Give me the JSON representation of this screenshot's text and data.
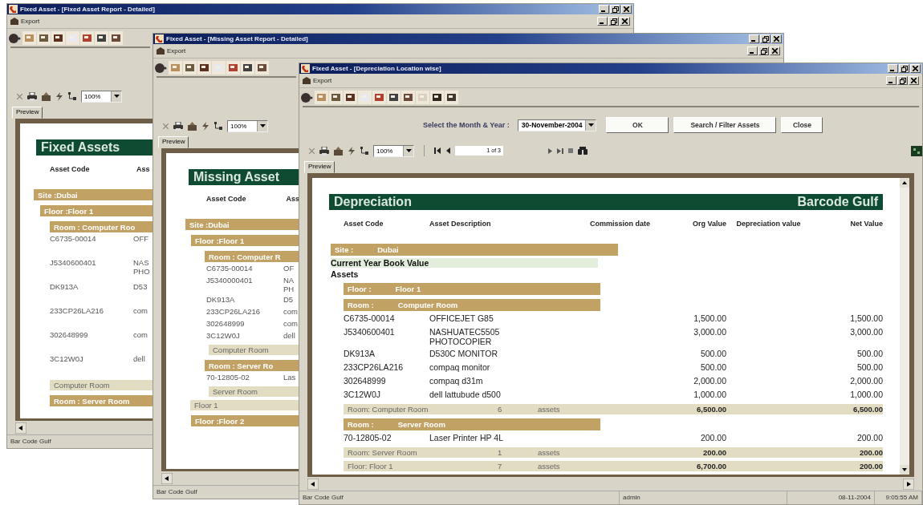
{
  "windows": [
    {
      "title": "Fixed Asset - [Fixed Asset Report - Detailed]",
      "menu": [
        "Export"
      ],
      "zoom": "100%",
      "tab": "Preview",
      "report": {
        "title": "Fixed Assets",
        "columns": [
          "Asset Code",
          "Ass"
        ],
        "lines": [
          {
            "kind": "site",
            "label": "Site :Dubai"
          },
          {
            "kind": "floor",
            "label": "Floor :Floor 1"
          },
          {
            "kind": "room",
            "label": "Room : Computer Roo"
          },
          {
            "kind": "item",
            "code": "C6735-00014",
            "description": [
              "OFF"
            ]
          },
          {
            "kind": "item",
            "code": "J5340600401",
            "description": [
              "NAS",
              "PHO"
            ]
          },
          {
            "kind": "item",
            "code": "DK913A",
            "description": [
              "D53"
            ]
          },
          {
            "kind": "item",
            "code": "233CP26LA216",
            "description": [
              "com"
            ]
          },
          {
            "kind": "item",
            "code": "302648999",
            "description": [
              "com"
            ]
          },
          {
            "kind": "item",
            "code": "3C12W0J",
            "description": [
              "dell"
            ]
          },
          {
            "kind": "room_total",
            "label": "Computer Room"
          },
          {
            "kind": "room",
            "label": "Room : Server Room"
          }
        ]
      },
      "status_bar": [
        "Bar Code Gulf"
      ]
    },
    {
      "title": "Fixed Asset - [Missing Asset Report - Detailed]",
      "menu": [
        "Export"
      ],
      "zoom": "100%",
      "tab": "Preview",
      "report": {
        "title": "Missing Asset",
        "columns": [
          "Asset Code",
          "Ass"
        ],
        "lines": [
          {
            "kind": "site",
            "label": "Site :Dubai"
          },
          {
            "kind": "floor",
            "label": "Floor :Floor 1"
          },
          {
            "kind": "room",
            "label": "Room : Computer R"
          },
          {
            "kind": "item",
            "code": "C6735-00014",
            "description": [
              "OF"
            ]
          },
          {
            "kind": "item",
            "code": "J5340000401",
            "description": [
              "NA",
              "PH"
            ]
          },
          {
            "kind": "item",
            "code": "DK913A",
            "description": [
              "D5"
            ]
          },
          {
            "kind": "item",
            "code": "233CP26LA216",
            "description": [
              "com"
            ]
          },
          {
            "kind": "item",
            "code": "302648999",
            "description": [
              "com"
            ]
          },
          {
            "kind": "item",
            "code": "3C12W0J",
            "description": [
              "dell"
            ]
          },
          {
            "kind": "room_total",
            "label": "Computer Room"
          },
          {
            "kind": "room",
            "label": "Room : Server Ro"
          },
          {
            "kind": "item",
            "code": "70-12805-02",
            "description": [
              "Las"
            ]
          },
          {
            "kind": "room_total",
            "label": "Server Room"
          },
          {
            "kind": "floor_total",
            "label": "Floor 1"
          },
          {
            "kind": "floor",
            "label": "Floor :Floor 2"
          }
        ]
      },
      "status_bar": [
        "Bar Code Gulf"
      ]
    },
    {
      "title": "Fixed Asset - [Depreciation Location wise]",
      "menu": [
        "Export"
      ],
      "zoom": "100%",
      "tab": "Preview",
      "filter": {
        "label": "Select the Month & Year :",
        "value": "30-November-2004",
        "buttons": [
          "OK",
          "Search / Filter Assets",
          "Close"
        ]
      },
      "pager": {
        "page": "1 of 3"
      },
      "report": {
        "title": "Depreciation",
        "company": "Barcode Gulf",
        "columns": [
          "Asset Code",
          "Asset Description",
          "Commission date",
          "Org Value",
          "Depreciation value",
          "Net Value"
        ],
        "lines": [
          {
            "kind": "site",
            "label": "Site :",
            "value": "Dubai"
          },
          {
            "kind": "book",
            "label": "Current Year Book Value"
          },
          {
            "kind": "heading",
            "label": "Assets"
          },
          {
            "kind": "floor",
            "label": "Floor :",
            "value": "Floor 1"
          },
          {
            "kind": "room",
            "label": "Room :",
            "value": "Computer Room"
          },
          {
            "kind": "item",
            "code": "C6735-00014",
            "description": [
              "OFFICEJET G85"
            ],
            "org_value": "1,500.00",
            "net_value": "1,500.00"
          },
          {
            "kind": "item",
            "code": "J5340600401",
            "description": [
              "NASHUATEC5505",
              "PHOTOCOPIER"
            ],
            "org_value": "3,000.00",
            "net_value": "3,000.00"
          },
          {
            "kind": "item",
            "code": "DK913A",
            "description": [
              "D530C MONITOR"
            ],
            "org_value": "500.00",
            "net_value": "500.00"
          },
          {
            "kind": "item",
            "code": "233CP26LA216",
            "description": [
              "compaq monitor"
            ],
            "org_value": "500.00",
            "net_value": "500.00"
          },
          {
            "kind": "item",
            "code": "302648999",
            "description": [
              "compaq d31m"
            ],
            "org_value": "2,000.00",
            "net_value": "2,000.00"
          },
          {
            "kind": "item",
            "code": "3C12W0J",
            "description": [
              "dell lattubude d500"
            ],
            "org_value": "1,000.00",
            "net_value": "1,000.00"
          },
          {
            "kind": "room_total",
            "label": "Room: Computer Room",
            "count": "6",
            "unit": "assets",
            "org_value": "6,500.00",
            "net_value": "6,500.00"
          },
          {
            "kind": "room",
            "label": "Room :",
            "value": "Server Room"
          },
          {
            "kind": "item",
            "code": "70-12805-02",
            "description": [
              "Laser Printer HP 4L"
            ],
            "org_value": "200.00",
            "net_value": "200.00"
          },
          {
            "kind": "room_total",
            "label": "Room: Server Room",
            "count": "1",
            "unit": "assets",
            "org_value": "200.00",
            "net_value": "200.00"
          },
          {
            "kind": "floor_total",
            "label": "Floor: Floor 1",
            "count": "7",
            "unit": "assets",
            "org_value": "6,700.00",
            "net_value": "200.00"
          }
        ]
      },
      "status_bar": [
        "Bar Code Gulf",
        "admin",
        "08-11-2004",
        "9:05:55 AM"
      ]
    }
  ]
}
